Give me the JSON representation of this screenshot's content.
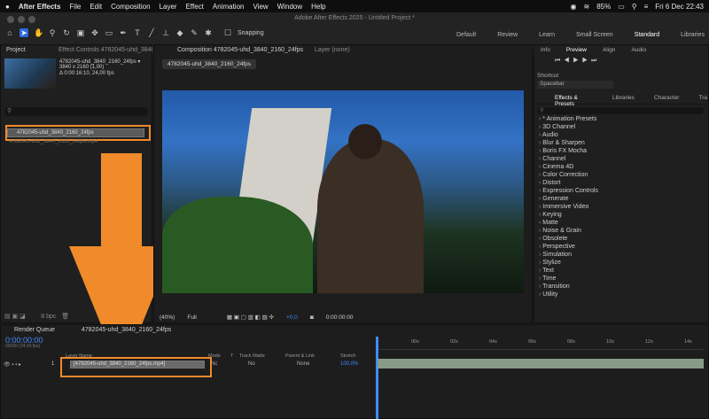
{
  "menubar": {
    "apple": "",
    "app": "After Effects",
    "items": [
      "File",
      "Edit",
      "Composition",
      "Layer",
      "Effect",
      "Animation",
      "View",
      "Window",
      "Help"
    ],
    "battery": "85%",
    "datetime": "Fri 6 Dec  22:43"
  },
  "app_title": "Adobe After Effects 2025 - Untitled Project *",
  "toolbar": {
    "snapping": "Snapping",
    "workspaces": [
      "Default",
      "Review",
      "Learn",
      "Small Screen",
      "Standard",
      "Libraries"
    ],
    "active_workspace": "Standard"
  },
  "project": {
    "tab": "Project",
    "effect_controls": "Effect Controls 4782045-uhd_3840_2160_24fps",
    "thumb_name": "4782045-uhd_3840_2160_24fps ▾",
    "thumb_res": "3840 x 2160 (1,00)",
    "thumb_dur": "Δ 0:00:16:10, 24,00 fps",
    "item1": "4782045-uhd_3840_2160_24fps",
    "item2": "4782045-uhd_3840_2160_24fps.mp4",
    "bpc": "8 bpc"
  },
  "comp": {
    "tab": "Composition 4782045-uhd_3840_2160_24fps",
    "layer_tab": "Layer (none)",
    "sub_tab": "4782045-uhd_3840_2160_24fps",
    "zoom": "(40%)",
    "quality": "Full",
    "offset": "+0,0",
    "timecode": "0:00:00:00"
  },
  "right": {
    "tabs": [
      "Info",
      "Preview",
      "Align",
      "Audio"
    ],
    "shortcut_label": "Shortcut",
    "shortcut_value": "Spacebar",
    "fx_tabs": [
      "Effects & Presets",
      "Libraries",
      "Character",
      "Tra"
    ],
    "search_placeholder": "⚲",
    "effects": [
      "* Animation Presets",
      "3D Channel",
      "Audio",
      "Blur & Sharpen",
      "Boris FX Mocha",
      "Channel",
      "Cinema 4D",
      "Color Correction",
      "Distort",
      "Expression Controls",
      "Generate",
      "Immersive Video",
      "Keying",
      "Matte",
      "Noise & Grain",
      "Obsolete",
      "Perspective",
      "Simulation",
      "Stylize",
      "Text",
      "Time",
      "Transition",
      "Utility"
    ]
  },
  "timeline": {
    "render_queue": "Render Queue",
    "comp_tab": "4782045-uhd_3840_2160_24fps",
    "timecode": "0:00:00:00",
    "frames": "00000 (24.00 fps)",
    "layer_header": "Layer Name",
    "mode": "Mode",
    "t": "T",
    "track_matte": "Track Matte",
    "parent": "Parent & Link",
    "stretch": "Stretch",
    "layer_num": "1",
    "layer_name": "[4782045-uhd_3840_2160_24fps.mp4]",
    "mode_val": "Nc",
    "matte_val": "No",
    "parent_val": "None",
    "stretch_val": "100,0%",
    "ruler": [
      "00s",
      "02s",
      "04s",
      "06s",
      "08s",
      "10s",
      "12s",
      "14s",
      "16s"
    ]
  },
  "colors": {
    "accent": "#2d6ae0",
    "orange": "#f08a2a",
    "timecode": "#3f8cff"
  }
}
